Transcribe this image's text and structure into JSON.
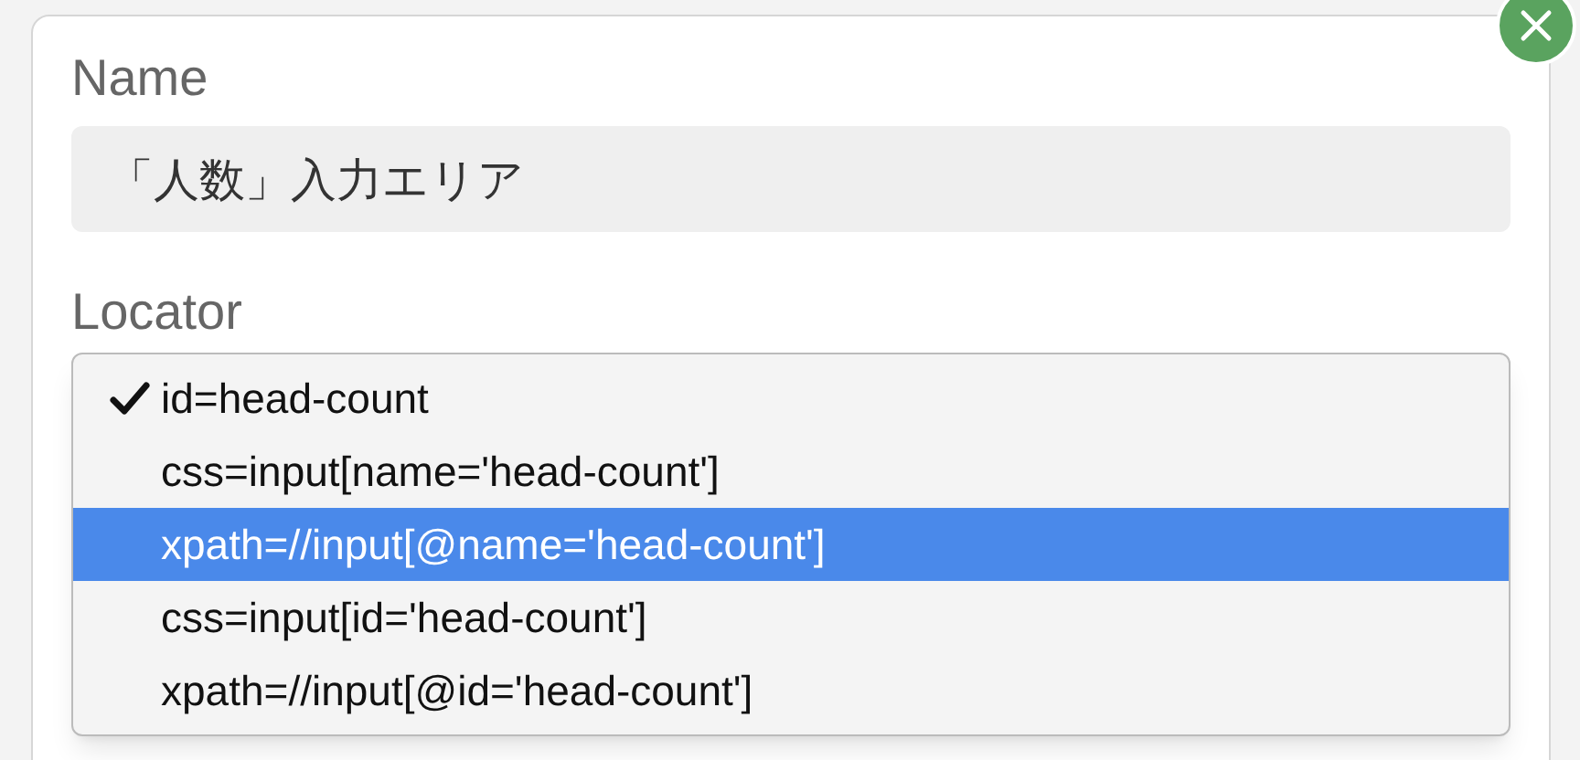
{
  "name_field": {
    "label": "Name",
    "value": "「人数」入力エリア"
  },
  "locator": {
    "label": "Locator",
    "options": [
      {
        "text": "id=head-count",
        "checked": true,
        "highlighted": false
      },
      {
        "text": "css=input[name='head-count']",
        "checked": false,
        "highlighted": false
      },
      {
        "text": "xpath=//input[@name='head-count']",
        "checked": false,
        "highlighted": true
      },
      {
        "text": "css=input[id='head-count']",
        "checked": false,
        "highlighted": false
      },
      {
        "text": "xpath=//input[@id='head-count']",
        "checked": false,
        "highlighted": false
      }
    ]
  }
}
